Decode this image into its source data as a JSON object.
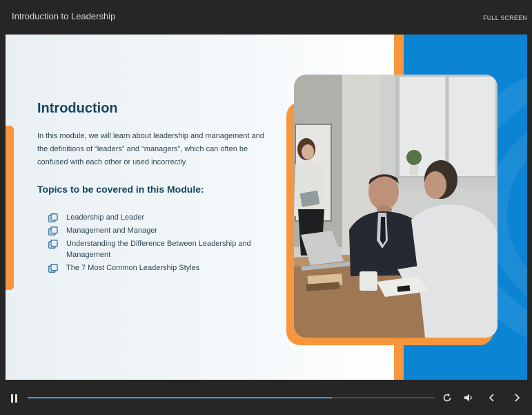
{
  "header": {
    "title": "Introduction to Leadership",
    "fullscreen_label": "FULL SCREEN"
  },
  "slide": {
    "heading": "Introduction",
    "intro_text": "In this module, we will learn about leadership and management and the definitions of “leaders” and “managers”, which can often be confused with each other or used incorrectly.",
    "topics_heading": "Topics to be covered in this Module:",
    "topics": [
      "Leadership and Leader",
      "Management and Manager",
      "Understanding the Difference Between Leadership and Management",
      "The 7 Most Common Leadership Styles"
    ],
    "topic_icon": "copy-icon",
    "image": "office-meeting-photo"
  },
  "player": {
    "progress": 0.747,
    "icons": [
      "pause-icon",
      "replay-icon",
      "volume-icon",
      "previous-icon",
      "next-icon"
    ]
  },
  "colors": {
    "accent_orange": "#f7963d",
    "accent_blue": "#0b84d4",
    "heading": "#17455f",
    "progress_fill": "#4f95d0"
  }
}
